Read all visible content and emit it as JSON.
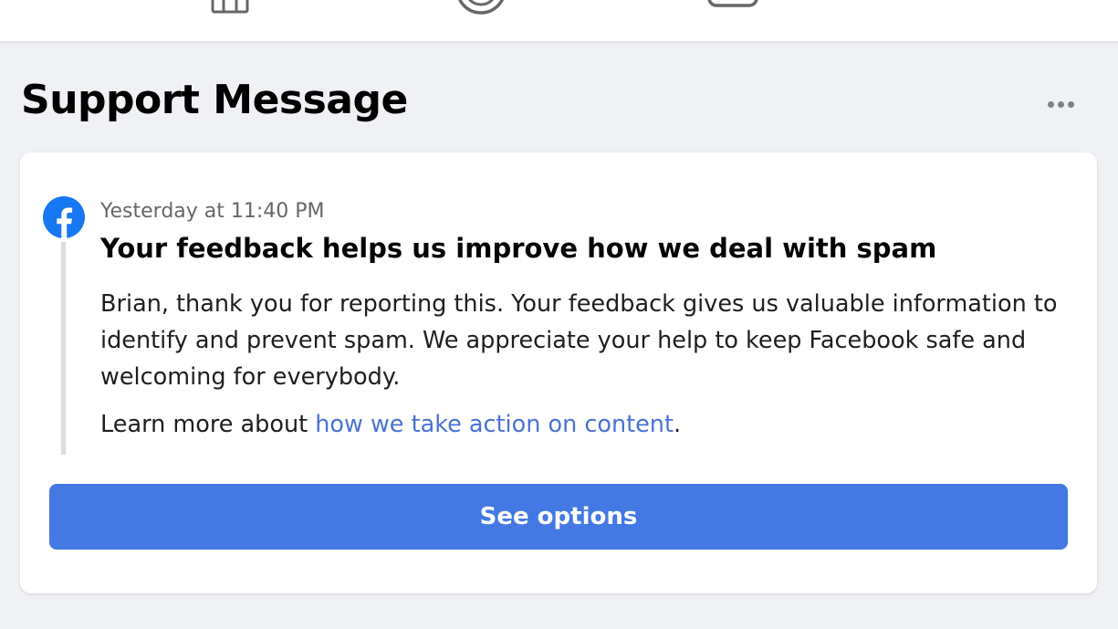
{
  "nav": {
    "icons": [
      "marketplace-icon",
      "groups-icon",
      "gaming-icon"
    ]
  },
  "header": {
    "title": "Support Message",
    "more_icon": "more-horizontal-icon"
  },
  "message": {
    "sender_icon": "facebook-logo-icon",
    "timestamp": "Yesterday at 11:40 PM",
    "title": "Your feedback helps us improve how we deal with spam",
    "body": "Brian, thank you for reporting this. Your feedback gives us valuable information to identify and prevent spam. We appreciate your help to keep Facebook safe and welcoming for everybody.",
    "learn_more_prefix": "Learn more about ",
    "learn_more_link": "how we take action on content",
    "learn_more_suffix": "."
  },
  "actions": {
    "see_options_label": "See options"
  },
  "colors": {
    "accent": "#4479e3",
    "link": "#4a72d3",
    "background": "#f0f1f5",
    "facebook_blue": "#1877f2"
  }
}
